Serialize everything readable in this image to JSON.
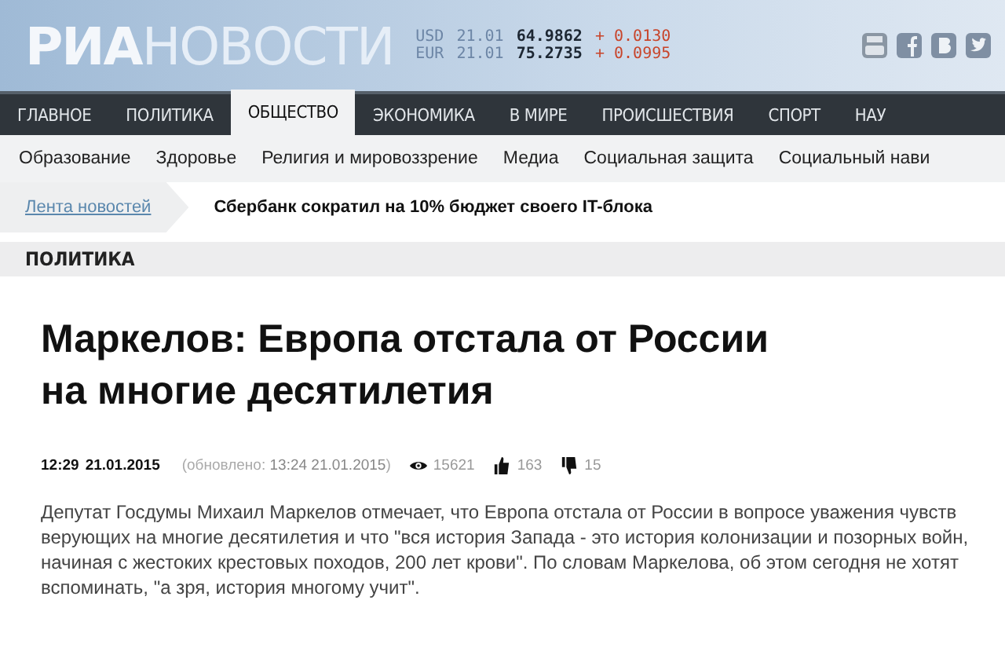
{
  "header": {
    "logo_bold": "РИА",
    "logo_light": "НОВОСТИ",
    "rates": [
      {
        "currency": "USD",
        "date": "21.01",
        "value": "64.9862",
        "change": "+ 0.0130"
      },
      {
        "currency": "EUR",
        "date": "21.01",
        "value": "75.2735",
        "change": "+ 0.0995"
      }
    ],
    "social": [
      {
        "kind": "youtube"
      },
      {
        "kind": "facebook"
      },
      {
        "kind": "vk"
      },
      {
        "kind": "twitter"
      }
    ]
  },
  "nav": [
    {
      "label": "ГЛАВНОЕ",
      "selected": false
    },
    {
      "label": "ПОЛИТИКА",
      "selected": false
    },
    {
      "label": "ОБЩЕСТВО",
      "selected": true
    },
    {
      "label": "ЭКОНОМИКА",
      "selected": false
    },
    {
      "label": "В МИРЕ",
      "selected": false
    },
    {
      "label": "ПРОИСШЕСТВИЯ",
      "selected": false
    },
    {
      "label": "СПОРТ",
      "selected": false
    },
    {
      "label": "НАУ",
      "selected": false
    }
  ],
  "subnav": [
    "Образование",
    "Здоровье",
    "Религия и мировоззрение",
    "Медиа",
    "Социальная защита",
    "Социальный нави"
  ],
  "ticker": {
    "link": "Лента новостей",
    "headline": "Сбербанк сократил на 10% бюджет своего IT-блока"
  },
  "section": "ПОЛИТИКА",
  "article": {
    "title": "Маркелов: Европа отстала от России на многие десятилетия",
    "time": "12:29",
    "date": "21.01.2015",
    "updated": "(обновлено: **13:24 21.01.2015**)",
    "views": "15621",
    "likes": "163",
    "dislikes": "15",
    "body": "Депутат Госдумы Михаил Маркелов отмечает, что Европа отстала от России в вопросе уважения чувств верующих на многие десятилетия и что \"вся история Запада - это история колонизации и позорных войн, начиная с жестоких крестовых походов, 200 лет крови\". По словам Маркелова, об этом сегодня не хотят вспоминать, \"а зря, история многому учит\"."
  }
}
